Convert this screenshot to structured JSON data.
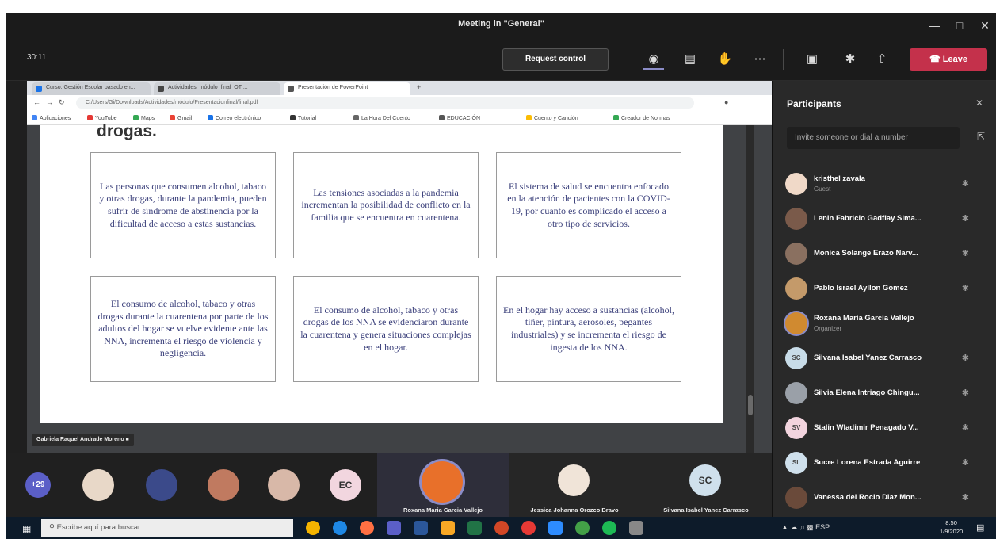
{
  "window": {
    "title": "Meeting in \"General\""
  },
  "toolbar": {
    "timer": "30:11",
    "request_control": "Request control",
    "leave": "Leave",
    "icons": [
      "participants-icon",
      "chat-icon",
      "raise-hand-icon",
      "more-options-icon",
      "camera-icon",
      "mic-off-icon",
      "share-tray-icon"
    ]
  },
  "browser": {
    "tabs": [
      {
        "label": "Curso: Gestión Escolar basado en..."
      },
      {
        "label": "Actividades_módulo_final_OT ..."
      },
      {
        "label": "Presentación de PowerPoint"
      }
    ],
    "address": "C:/Users/Gi/Downloads/Actividades/módulo/Presentacionfinal/final.pdf",
    "bookmarks": [
      "Aplicaciones",
      "YouTube",
      "Maps",
      "Gmail",
      "Correo electrónico",
      "Tutorial",
      "La Hora Del Cuento",
      "EDUCACIÓN",
      "Cuento y Canción",
      "Creador de Normas"
    ]
  },
  "slide": {
    "heading": "drogas.",
    "cards": [
      "Las personas que consumen alcohol, tabaco y otras drogas, durante la pandemia, pueden sufrir de síndrome de abstinencia por la dificultad de acceso a estas sustancias.",
      "Las tensiones asociadas a la pandemia incrementan la posibilidad de conflicto en la familia que se encuentra en cuarentena.",
      "El sistema de salud se encuentra enfocado en la atención de pacientes con la COVID-19, por cuanto es complicado el acceso a otro tipo de servicios.",
      "El consumo de alcohol, tabaco y otras drogas durante la cuarentena por parte de los adultos del hogar se vuelve evidente ante las NNA, incrementa el riesgo de violencia y negligencia.",
      "El consumo de alcohol, tabaco y otras drogas de los NNA se evidenciaron durante la cuarentena y genera situaciones complejas en el hogar.",
      "En el hogar hay acceso a sustancias (alcohol, tiñer, pintura, aerosoles, pegantes industriales) y se incrementa el riesgo de ingesta de los NNA."
    ],
    "presenter": "Gabriela Raquel Andrade Moreno"
  },
  "participants": {
    "title": "Participants",
    "invite_placeholder": "Invite someone or dial a number",
    "list": [
      {
        "name": "kristhel zavala",
        "role": "Guest",
        "initials": "",
        "color": "#f0d9c8"
      },
      {
        "name": "Lenin Fabricio Gadfiay Sima...",
        "role": "",
        "initials": "",
        "color": "#7a5a4a"
      },
      {
        "name": "Monica Solange Erazo Narv...",
        "role": "",
        "initials": "",
        "color": "#8a7060"
      },
      {
        "name": "Pablo Israel Ayllon Gomez",
        "role": "",
        "initials": "",
        "color": "#c49a6a"
      },
      {
        "name": "Roxana Maria Garcia Vallejo",
        "role": "Organizer",
        "initials": "",
        "color": "#d08a30"
      },
      {
        "name": "Silvana Isabel Yanez Carrasco",
        "role": "",
        "initials": "SC",
        "color": "#c8dce8"
      },
      {
        "name": "Silvia Elena Intriago Chingu...",
        "role": "",
        "initials": "",
        "color": "#9aa0a8"
      },
      {
        "name": "Stalin Wladimir Penagado V...",
        "role": "",
        "initials": "SV",
        "color": "#f2d4de"
      },
      {
        "name": "Sucre Lorena Estrada Aguirre",
        "role": "",
        "initials": "SL",
        "color": "#cfe0ec"
      },
      {
        "name": "Vanessa del Rocio Diaz Mon...",
        "role": "",
        "initials": "",
        "color": "#6a4a3a"
      }
    ]
  },
  "video_strip": {
    "overflow_count": "+29",
    "tiles": [
      {
        "initials": "",
        "name": "",
        "color": "#e8d8c8"
      },
      {
        "initials": "",
        "name": "",
        "color": "#3b4a8a"
      },
      {
        "initials": "",
        "name": "",
        "color": "#c07a60"
      },
      {
        "initials": "",
        "name": "",
        "color": "#d8b8a8"
      },
      {
        "initials": "EC",
        "name": "",
        "color": "#f2d6df"
      }
    ],
    "named": [
      {
        "name": "Roxana Maria Garcia Vallejo",
        "initials": "",
        "color": "#e8702a"
      },
      {
        "name": "Jessica Johanna Orozco Bravo",
        "initials": "",
        "color": "#f0e4d8"
      },
      {
        "name": "Silvana Isabel Yanez Carrasco",
        "initials": "SC",
        "color": "#cfe0ec"
      }
    ]
  },
  "taskbar": {
    "search_placeholder": "Escribe aquí para buscar",
    "tray": "ESP",
    "time": "8:50",
    "date": "1/9/2020"
  }
}
